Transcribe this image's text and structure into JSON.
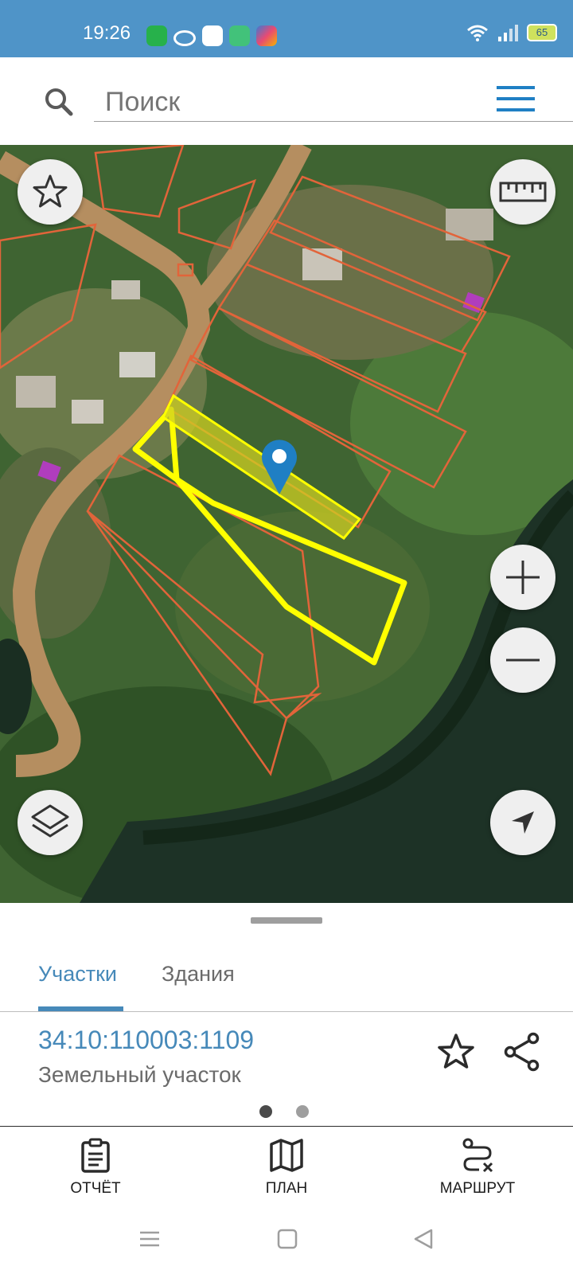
{
  "status_bar": {
    "time": "19:26",
    "battery_level": "65",
    "app_icons": [
      {
        "name": "messenger-icon",
        "color": "#27b14b"
      },
      {
        "name": "loop-icon",
        "color": "#4f94c8"
      },
      {
        "name": "wb-icon",
        "color": "#ffffff"
      },
      {
        "name": "phone-icon",
        "color": "#42c27a"
      },
      {
        "name": "star-app-icon",
        "color": "#e84a73"
      }
    ]
  },
  "search": {
    "placeholder": "Поиск"
  },
  "tabs": [
    {
      "label": "Участки",
      "active": true
    },
    {
      "label": "Здания",
      "active": false
    }
  ],
  "parcel": {
    "cadastral_number": "34:10:110003:1109",
    "type": "Земельный участок"
  },
  "pagination": {
    "pages": 2,
    "current": 1
  },
  "actions": [
    {
      "label": "ОТЧЁТ",
      "icon": "clipboard-icon"
    },
    {
      "label": "ПЛАН",
      "icon": "map-icon"
    },
    {
      "label": "МАРШРУТ",
      "icon": "route-icon"
    }
  ],
  "colors": {
    "accent": "#4689b9",
    "status_bar": "#4f94c8",
    "parcel_boundary": "#e2643a",
    "selected_parcel": "#ffff00",
    "marker": "#1f7fc4"
  }
}
